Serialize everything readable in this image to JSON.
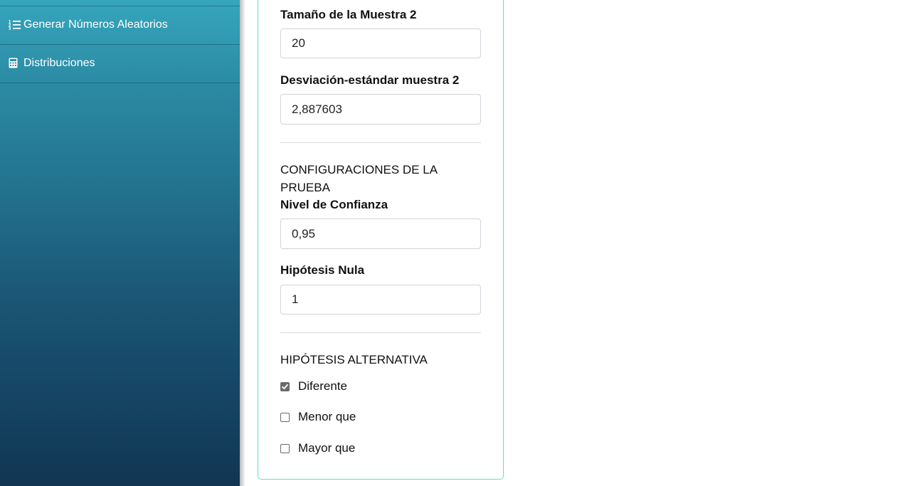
{
  "sidebar": {
    "items": [
      {
        "label": "Generar Números Aleatorios",
        "icon": "list-ol-icon"
      },
      {
        "label": "Distribuciones",
        "icon": "calculator-icon"
      }
    ]
  },
  "form": {
    "sample2_size": {
      "label": "Tamaño de la Muestra 2",
      "value": "20"
    },
    "sample2_std": {
      "label": "Desviación-estándar muestra 2",
      "value": "2,887603"
    },
    "test_config_title": "CONFIGURACIONES DE LA PRUEBA",
    "confidence": {
      "label": "Nivel de Confianza",
      "value": "0,95"
    },
    "null_hypothesis": {
      "label": "Hipótesis Nula",
      "value": "1"
    },
    "alternative_title": "HIPÓTESIS ALTERNATIVA",
    "alternatives": [
      {
        "label": "Diferente",
        "checked": true
      },
      {
        "label": "Menor que",
        "checked": false
      },
      {
        "label": "Mayor que",
        "checked": false
      }
    ]
  },
  "colors": {
    "sidebar_top": "#36a6bd",
    "sidebar_bottom": "#113553",
    "card_border": "#5fe0c6"
  }
}
